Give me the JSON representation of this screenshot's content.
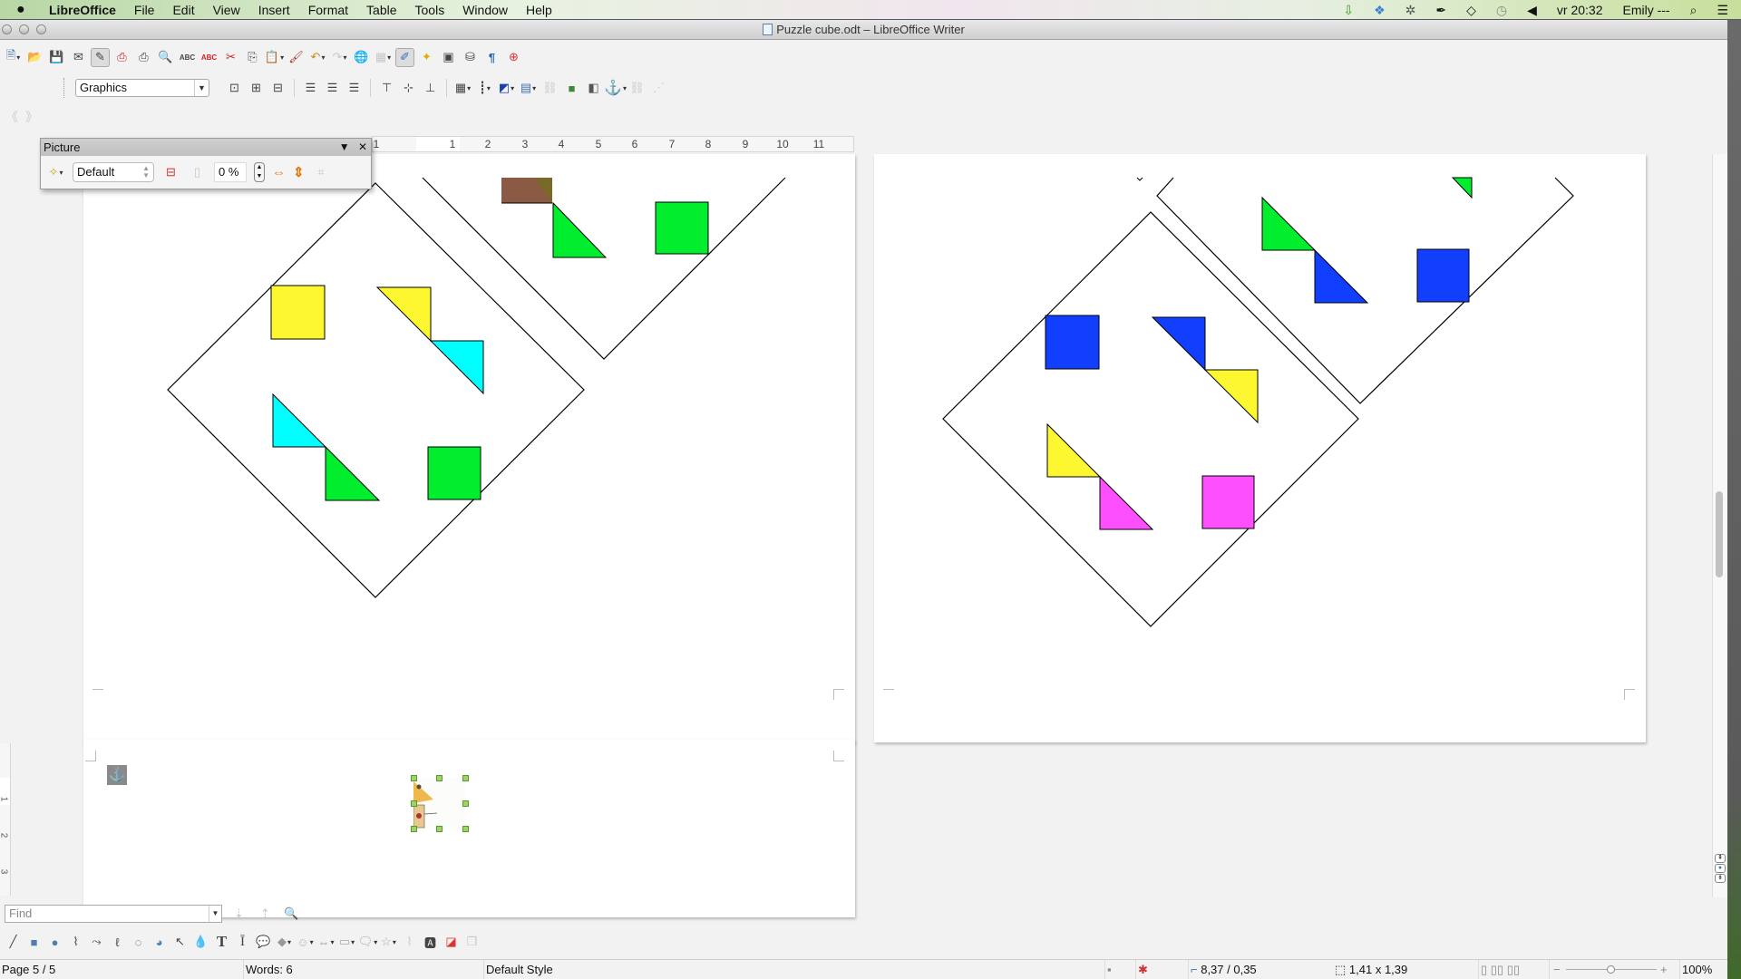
{
  "menubar": {
    "apple": "",
    "items": [
      "LibreOffice",
      "File",
      "Edit",
      "View",
      "Insert",
      "Format",
      "Table",
      "Tools",
      "Window",
      "Help"
    ],
    "clock": "vr 20:32",
    "user": "Emily ---"
  },
  "window": {
    "title": "Puzzle cube.odt – LibreOffice Writer"
  },
  "formatting": {
    "paragraph_style": "Graphics"
  },
  "ruler": {
    "labels": [
      "1",
      "1",
      "2",
      "3",
      "4",
      "5",
      "6",
      "7",
      "8",
      "9",
      "10",
      "11"
    ]
  },
  "vruler": {
    "labels": [
      "1",
      "2",
      "3"
    ]
  },
  "picture_toolbar": {
    "title": "Picture",
    "graphics_mode": "Default",
    "transparency": "0 %"
  },
  "find": {
    "placeholder": "Find",
    "value": ""
  },
  "document": {
    "colors": {
      "green": "#00ee2e",
      "yellow": "#fdf732",
      "cyan": "#00ffff",
      "blue": "#123ffe",
      "magenta": "#fd4ffd",
      "brown": "#8a5a44",
      "outline": "#000000"
    },
    "pages": [
      {
        "name": "page-left-top",
        "diamonds": [
          {
            "name": "large-diamond",
            "pieces": [
              {
                "type": "square",
                "color": "yellow"
              },
              {
                "type": "triangle-pair",
                "colors": [
                  "yellow",
                  "cyan"
                ]
              },
              {
                "type": "triangle-pair",
                "colors": [
                  "cyan",
                  "green"
                ]
              },
              {
                "type": "square",
                "color": "green"
              }
            ]
          },
          {
            "name": "partial-diamond",
            "pieces": [
              {
                "type": "triangle-pair",
                "colors": [
                  "brown",
                  "green"
                ]
              },
              {
                "type": "square",
                "color": "green"
              }
            ]
          }
        ]
      },
      {
        "name": "page-right-top",
        "diamonds": [
          {
            "name": "large-diamond",
            "pieces": [
              {
                "type": "square",
                "color": "blue"
              },
              {
                "type": "triangle-pair",
                "colors": [
                  "blue",
                  "yellow"
                ]
              },
              {
                "type": "triangle-pair",
                "colors": [
                  "yellow",
                  "magenta"
                ]
              },
              {
                "type": "square",
                "color": "magenta"
              }
            ]
          },
          {
            "name": "partial-diamond",
            "pieces": [
              {
                "type": "triangle-pair",
                "colors": [
                  "green",
                  "blue"
                ]
              },
              {
                "type": "square",
                "color": "blue"
              },
              {
                "type": "triangle-partial",
                "color": "green"
              }
            ]
          }
        ]
      }
    ]
  },
  "status": {
    "page": "Page 5 / 5",
    "words": "Words: 6",
    "page_style": "Default Style",
    "position": "8,37 / 0,35",
    "size": "1,41 x 1,39",
    "zoom": "100%",
    "zoom_level": 1.0
  }
}
